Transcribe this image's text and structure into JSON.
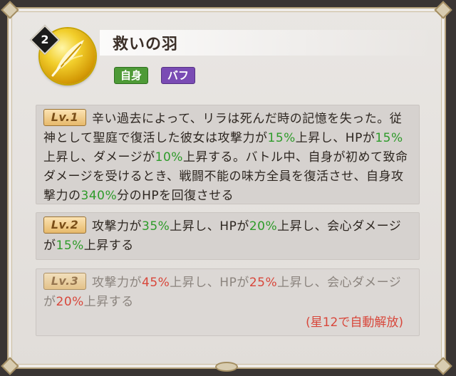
{
  "skill": {
    "number": "2",
    "title": "救いの羽",
    "tags": [
      "自身",
      "バフ"
    ],
    "icon": "feather-icon"
  },
  "levels": [
    {
      "badge": "Lv.1",
      "segments": [
        {
          "text": "辛い過去によって、リラは死んだ時の記憶を失った。従神として聖庭で復活した彼女は攻撃力が"
        },
        {
          "text": "15%",
          "hl": "g"
        },
        {
          "text": "上昇し、HPが"
        },
        {
          "text": "15%",
          "hl": "g"
        },
        {
          "text": "上昇し、ダメージが"
        },
        {
          "text": "10%",
          "hl": "g"
        },
        {
          "text": "上昇する。バトル中、自身が初めて致命ダメージを受けるとき、戦闘不能の味方全員を復活させ、自身攻撃力の"
        },
        {
          "text": "340%",
          "hl": "g"
        },
        {
          "text": "分のHPを回復させる"
        }
      ]
    },
    {
      "badge": "Lv.2",
      "segments": [
        {
          "text": "攻撃力が"
        },
        {
          "text": "35%",
          "hl": "g"
        },
        {
          "text": "上昇し、HPが"
        },
        {
          "text": "20%",
          "hl": "g"
        },
        {
          "text": "上昇し、会心ダメージが"
        },
        {
          "text": "15%",
          "hl": "g"
        },
        {
          "text": "上昇する"
        }
      ]
    },
    {
      "badge": "Lv.3",
      "segments": [
        {
          "text": "攻撃力が"
        },
        {
          "text": "45%",
          "hl": "r"
        },
        {
          "text": "上昇し、HPが"
        },
        {
          "text": "25%",
          "hl": "r"
        },
        {
          "text": "上昇し、会心ダメージが"
        },
        {
          "text": "20%",
          "hl": "r"
        },
        {
          "text": "上昇する"
        }
      ],
      "unlock_note": "(星12で自動解放)"
    }
  ],
  "colors": {
    "highlight_green": "#2e9b2a",
    "highlight_red": "#d8473b",
    "tag_self": "#4e9a37",
    "tag_buff": "#7a4bb4"
  }
}
